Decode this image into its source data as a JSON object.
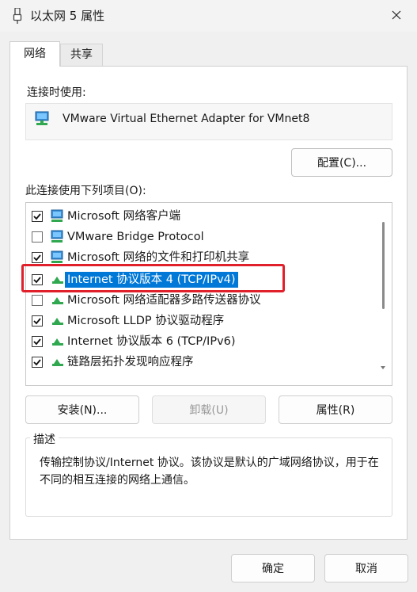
{
  "window": {
    "title": "以太网 5 属性"
  },
  "tabs": [
    {
      "label": "网络",
      "active": true
    },
    {
      "label": "共享",
      "active": false
    }
  ],
  "connect_using": {
    "label": "连接时使用:",
    "adapter": "VMware Virtual Ethernet Adapter for VMnet8",
    "configure_label": "配置(C)..."
  },
  "items_label": "此连接使用下列项目(O):",
  "items": [
    {
      "label": "Microsoft 网络客户端",
      "checked": true,
      "icon": "network-client-icon"
    },
    {
      "label": "VMware Bridge Protocol",
      "checked": false,
      "icon": "network-client-icon"
    },
    {
      "label": "Microsoft 网络的文件和打印机共享",
      "checked": true,
      "icon": "network-client-icon"
    },
    {
      "label": "Internet 协议版本 4 (TCP/IPv4)",
      "checked": true,
      "selected": true,
      "icon": "protocol-icon"
    },
    {
      "label": "Microsoft 网络适配器多路传送器协议",
      "checked": false,
      "icon": "protocol-icon"
    },
    {
      "label": "Microsoft LLDP 协议驱动程序",
      "checked": true,
      "icon": "protocol-icon"
    },
    {
      "label": "Internet 协议版本 6 (TCP/IPv6)",
      "checked": true,
      "icon": "protocol-icon"
    },
    {
      "label": "链路层拓扑发现响应程序",
      "checked": true,
      "icon": "protocol-icon"
    }
  ],
  "buttons": {
    "install": "安装(N)...",
    "uninstall": "卸载(U)",
    "properties": "属性(R)",
    "ok": "确定",
    "cancel": "取消"
  },
  "description": {
    "label": "描述",
    "text": "传输控制协议/Internet 协议。该协议是默认的广域网络协议，用于在不同的相互连接的网络上通信。"
  },
  "colors": {
    "selection": "#0078d7",
    "highlight_box": "#e0202a",
    "protocol_icon": "#2fa84f"
  }
}
